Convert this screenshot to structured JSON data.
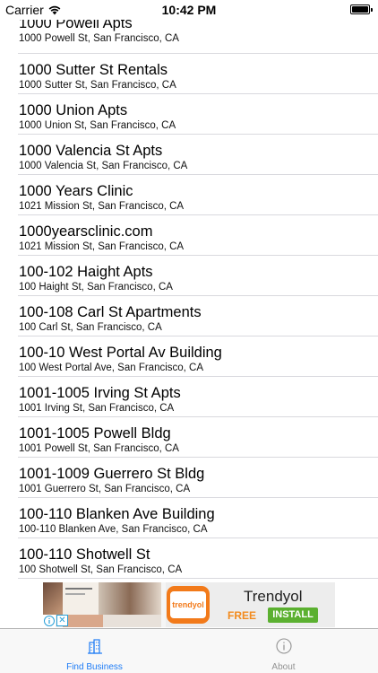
{
  "status_bar": {
    "carrier": "Carrier",
    "time": "10:42 PM"
  },
  "businesses": [
    {
      "name": "1000 Powell Apts",
      "address": "1000 Powell St, San Francisco, CA"
    },
    {
      "name": "1000 Sutter St Rentals",
      "address": "1000 Sutter St, San Francisco, CA"
    },
    {
      "name": "1000 Union Apts",
      "address": "1000 Union St, San Francisco, CA"
    },
    {
      "name": "1000 Valencia St Apts",
      "address": "1000 Valencia St, San Francisco, CA"
    },
    {
      "name": "1000 Years Clinic",
      "address": "1021 Mission St, San Francisco, CA"
    },
    {
      "name": "1000yearsclinic.com",
      "address": "1021 Mission St, San Francisco, CA"
    },
    {
      "name": "100-102 Haight Apts",
      "address": "100 Haight St, San Francisco, CA"
    },
    {
      "name": "100-108 Carl St Apartments",
      "address": "100 Carl St, San Francisco, CA"
    },
    {
      "name": "100-10 West Portal Av Building",
      "address": "100 West Portal Ave, San Francisco, CA"
    },
    {
      "name": "1001-1005 Irving St Apts",
      "address": "1001 Irving St, San Francisco, CA"
    },
    {
      "name": "1001-1005 Powell Bldg",
      "address": "1001 Powell St, San Francisco, CA"
    },
    {
      "name": "1001-1009 Guerrero St Bldg",
      "address": "1001 Guerrero St, San Francisco, CA"
    },
    {
      "name": "100-110 Blanken Ave Building",
      "address": "100-110 Blanken Ave, San Francisco, CA"
    },
    {
      "name": "100-110 Shotwell St",
      "address": "100 Shotwell St, San Francisco, CA"
    }
  ],
  "ad": {
    "app_name": "Trendyol",
    "price": "FREE",
    "install_label": "INSTALL",
    "logo_text": "trendyol",
    "close_label": "✕"
  },
  "tab_bar": {
    "tabs": [
      {
        "label": "Find Business",
        "icon": "building-icon",
        "color": "#1f7cf6",
        "selected": true
      },
      {
        "label": "About",
        "icon": "info-icon",
        "color": "#929292",
        "selected": false
      }
    ]
  }
}
